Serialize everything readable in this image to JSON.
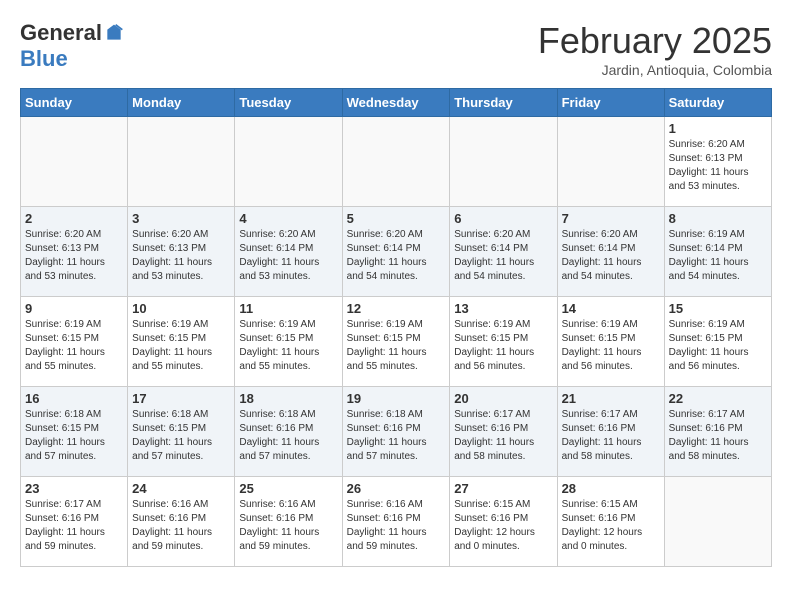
{
  "header": {
    "logo_general": "General",
    "logo_blue": "Blue",
    "month_title": "February 2025",
    "location": "Jardin, Antioquia, Colombia"
  },
  "weekdays": [
    "Sunday",
    "Monday",
    "Tuesday",
    "Wednesday",
    "Thursday",
    "Friday",
    "Saturday"
  ],
  "weeks": [
    [
      {
        "day": "",
        "info": ""
      },
      {
        "day": "",
        "info": ""
      },
      {
        "day": "",
        "info": ""
      },
      {
        "day": "",
        "info": ""
      },
      {
        "day": "",
        "info": ""
      },
      {
        "day": "",
        "info": ""
      },
      {
        "day": "1",
        "info": "Sunrise: 6:20 AM\nSunset: 6:13 PM\nDaylight: 11 hours\nand 53 minutes."
      }
    ],
    [
      {
        "day": "2",
        "info": "Sunrise: 6:20 AM\nSunset: 6:13 PM\nDaylight: 11 hours\nand 53 minutes."
      },
      {
        "day": "3",
        "info": "Sunrise: 6:20 AM\nSunset: 6:13 PM\nDaylight: 11 hours\nand 53 minutes."
      },
      {
        "day": "4",
        "info": "Sunrise: 6:20 AM\nSunset: 6:14 PM\nDaylight: 11 hours\nand 53 minutes."
      },
      {
        "day": "5",
        "info": "Sunrise: 6:20 AM\nSunset: 6:14 PM\nDaylight: 11 hours\nand 54 minutes."
      },
      {
        "day": "6",
        "info": "Sunrise: 6:20 AM\nSunset: 6:14 PM\nDaylight: 11 hours\nand 54 minutes."
      },
      {
        "day": "7",
        "info": "Sunrise: 6:20 AM\nSunset: 6:14 PM\nDaylight: 11 hours\nand 54 minutes."
      },
      {
        "day": "8",
        "info": "Sunrise: 6:19 AM\nSunset: 6:14 PM\nDaylight: 11 hours\nand 54 minutes."
      }
    ],
    [
      {
        "day": "9",
        "info": "Sunrise: 6:19 AM\nSunset: 6:15 PM\nDaylight: 11 hours\nand 55 minutes."
      },
      {
        "day": "10",
        "info": "Sunrise: 6:19 AM\nSunset: 6:15 PM\nDaylight: 11 hours\nand 55 minutes."
      },
      {
        "day": "11",
        "info": "Sunrise: 6:19 AM\nSunset: 6:15 PM\nDaylight: 11 hours\nand 55 minutes."
      },
      {
        "day": "12",
        "info": "Sunrise: 6:19 AM\nSunset: 6:15 PM\nDaylight: 11 hours\nand 55 minutes."
      },
      {
        "day": "13",
        "info": "Sunrise: 6:19 AM\nSunset: 6:15 PM\nDaylight: 11 hours\nand 56 minutes."
      },
      {
        "day": "14",
        "info": "Sunrise: 6:19 AM\nSunset: 6:15 PM\nDaylight: 11 hours\nand 56 minutes."
      },
      {
        "day": "15",
        "info": "Sunrise: 6:19 AM\nSunset: 6:15 PM\nDaylight: 11 hours\nand 56 minutes."
      }
    ],
    [
      {
        "day": "16",
        "info": "Sunrise: 6:18 AM\nSunset: 6:15 PM\nDaylight: 11 hours\nand 57 minutes."
      },
      {
        "day": "17",
        "info": "Sunrise: 6:18 AM\nSunset: 6:15 PM\nDaylight: 11 hours\nand 57 minutes."
      },
      {
        "day": "18",
        "info": "Sunrise: 6:18 AM\nSunset: 6:16 PM\nDaylight: 11 hours\nand 57 minutes."
      },
      {
        "day": "19",
        "info": "Sunrise: 6:18 AM\nSunset: 6:16 PM\nDaylight: 11 hours\nand 57 minutes."
      },
      {
        "day": "20",
        "info": "Sunrise: 6:17 AM\nSunset: 6:16 PM\nDaylight: 11 hours\nand 58 minutes."
      },
      {
        "day": "21",
        "info": "Sunrise: 6:17 AM\nSunset: 6:16 PM\nDaylight: 11 hours\nand 58 minutes."
      },
      {
        "day": "22",
        "info": "Sunrise: 6:17 AM\nSunset: 6:16 PM\nDaylight: 11 hours\nand 58 minutes."
      }
    ],
    [
      {
        "day": "23",
        "info": "Sunrise: 6:17 AM\nSunset: 6:16 PM\nDaylight: 11 hours\nand 59 minutes."
      },
      {
        "day": "24",
        "info": "Sunrise: 6:16 AM\nSunset: 6:16 PM\nDaylight: 11 hours\nand 59 minutes."
      },
      {
        "day": "25",
        "info": "Sunrise: 6:16 AM\nSunset: 6:16 PM\nDaylight: 11 hours\nand 59 minutes."
      },
      {
        "day": "26",
        "info": "Sunrise: 6:16 AM\nSunset: 6:16 PM\nDaylight: 11 hours\nand 59 minutes."
      },
      {
        "day": "27",
        "info": "Sunrise: 6:15 AM\nSunset: 6:16 PM\nDaylight: 12 hours\nand 0 minutes."
      },
      {
        "day": "28",
        "info": "Sunrise: 6:15 AM\nSunset: 6:16 PM\nDaylight: 12 hours\nand 0 minutes."
      },
      {
        "day": "",
        "info": ""
      }
    ]
  ]
}
